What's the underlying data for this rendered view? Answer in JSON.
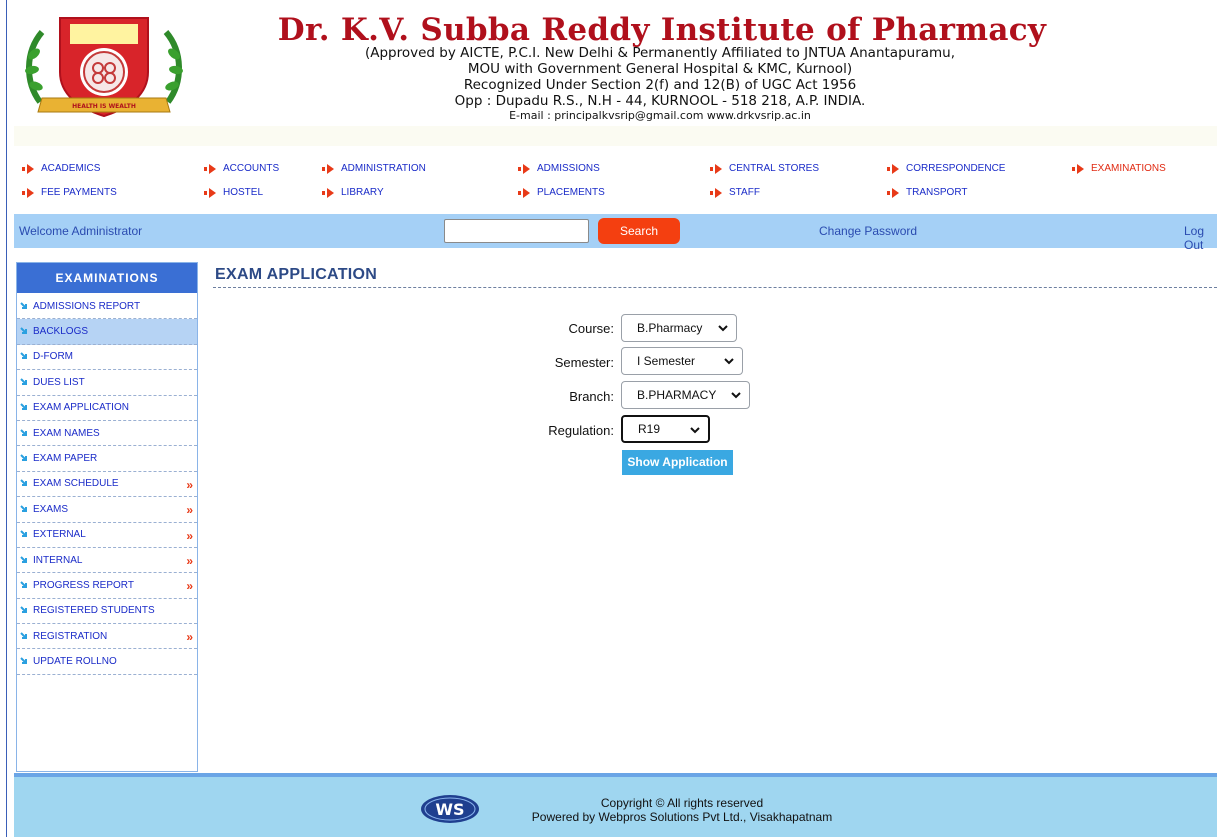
{
  "header": {
    "institute_name": "Dr. K.V. Subba Reddy Institute of Pharmacy",
    "line1": "(Approved by AICTE, P.C.I. New Delhi & Permanently Affiliated to JNTUA Anantapuramu,",
    "line2": "MOU with Government General Hospital & KMC, Kurnool)",
    "line3": "Recognized Under Section 2(f) and 12(B) of UGC Act 1956",
    "line4": "Opp : Dupadu R.S., N.H - 44, KURNOOL - 518 218, A.P. INDIA.",
    "line5": "E-mail : principalkvsrip@gmail.com    www.drkvsrip.ac.in",
    "logo_text": "HEALTH IS WEALTH"
  },
  "top_menu": [
    {
      "label": "ACADEMICS"
    },
    {
      "label": "ACCOUNTS"
    },
    {
      "label": "ADMINISTRATION"
    },
    {
      "label": "ADMISSIONS"
    },
    {
      "label": "CENTRAL STORES"
    },
    {
      "label": "CORRESPONDENCE"
    },
    {
      "label": "EXAMINATIONS"
    },
    {
      "label": "FEE PAYMENTS"
    },
    {
      "label": "HOSTEL"
    },
    {
      "label": "LIBRARY"
    },
    {
      "label": "PLACEMENTS"
    },
    {
      "label": "STAFF"
    },
    {
      "label": "TRANSPORT"
    }
  ],
  "welcome_bar": {
    "welcome_text": "Welcome Administrator",
    "search_value": "",
    "search_button": "Search",
    "change_password": "Change Password",
    "logout": "Log Out"
  },
  "sidebar": {
    "title": "EXAMINATIONS",
    "items": [
      {
        "label": "ADMISSIONS REPORT"
      },
      {
        "label": "BACKLOGS"
      },
      {
        "label": "D-FORM"
      },
      {
        "label": "DUES LIST"
      },
      {
        "label": "EXAM APPLICATION"
      },
      {
        "label": "EXAM NAMES"
      },
      {
        "label": "EXAM PAPER"
      },
      {
        "label": "EXAM SCHEDULE"
      },
      {
        "label": "EXAMS"
      },
      {
        "label": "EXTERNAL"
      },
      {
        "label": "INTERNAL"
      },
      {
        "label": "PROGRESS REPORT"
      },
      {
        "label": "REGISTERED STUDENTS"
      },
      {
        "label": "REGISTRATION"
      },
      {
        "label": "UPDATE ROLLNO"
      }
    ],
    "submenu_marker": "»"
  },
  "main": {
    "title": "EXAM APPLICATION",
    "form": {
      "course_label": "Course:",
      "course_value": "B.Pharmacy",
      "semester_label": "Semester:",
      "semester_value": "I Semester",
      "branch_label": "Branch:",
      "branch_value": "B.PHARMACY",
      "regulation_label": "Regulation:",
      "regulation_value": "R19",
      "show_button": "Show Application"
    }
  },
  "footer": {
    "copyright": "Copyright ©  All rights reserved",
    "powered_by": "Powered by Webpros Solutions Pvt Ltd., Visakhapatnam",
    "logo_text": "WS"
  },
  "colors": {
    "title_red": "#b0101c",
    "menu_link": "#1a2bc8",
    "menu_active": "#e02a12",
    "welcome_bar": "#a5d0f6",
    "search_button": "#f43f10",
    "sidebar_header": "#3a6fd4",
    "sidebar_active": "#b6d3f4",
    "show_button": "#3aa8e2",
    "footer": "#9fd6f0"
  }
}
